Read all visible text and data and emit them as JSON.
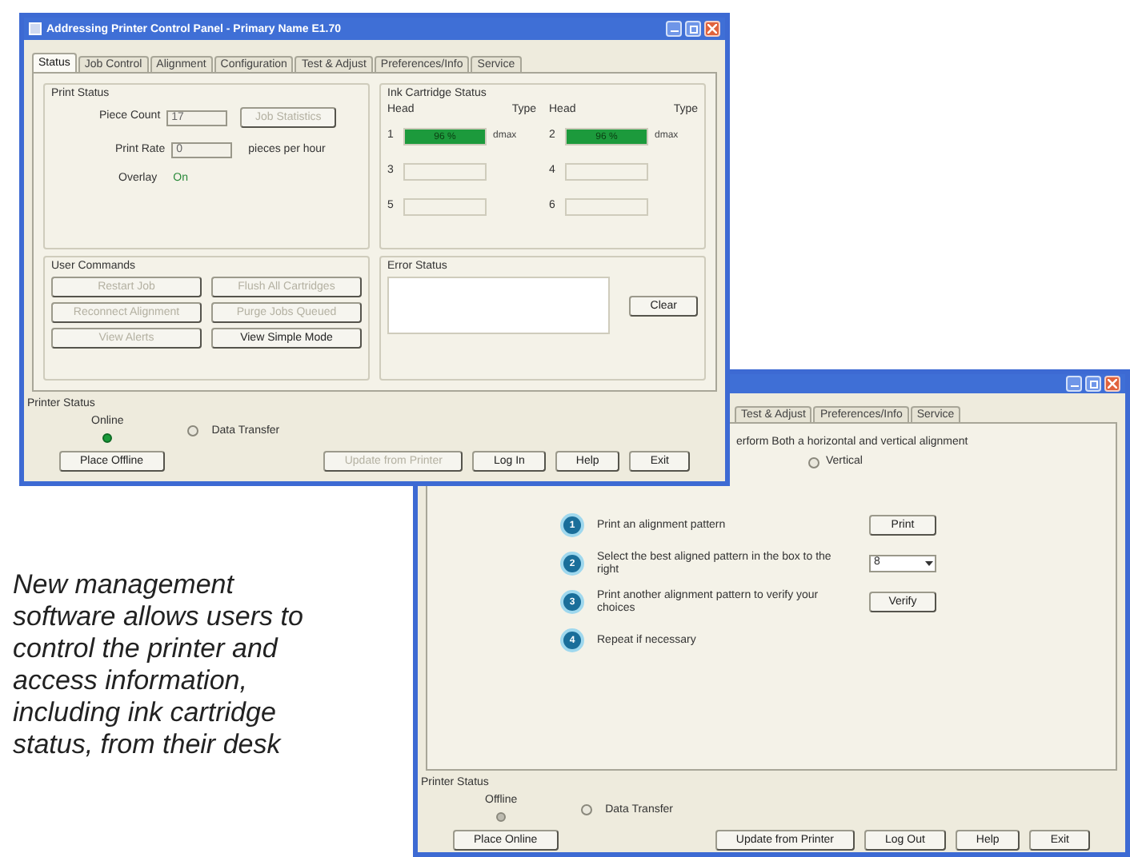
{
  "main_window": {
    "title": "Addressing Printer Control Panel - Primary Name E1.70",
    "tabs": [
      {
        "label": "Status",
        "selected": true
      },
      {
        "label": "Job Control",
        "selected": false
      },
      {
        "label": "Alignment",
        "selected": false
      },
      {
        "label": "Configuration",
        "selected": false
      },
      {
        "label": "Test & Adjust",
        "selected": false
      },
      {
        "label": "Preferences/Info",
        "selected": false
      },
      {
        "label": "Service",
        "selected": false
      }
    ],
    "print_status": {
      "title": "Print Status",
      "piece_count_label": "Piece Count",
      "piece_count_value": "17",
      "statistics_button": "Job Statistics",
      "print_rate_label": "Print Rate",
      "print_rate_value": "0",
      "print_rate_unit": "pieces per hour",
      "overlay_label": "Overlay",
      "overlay_value": "On"
    },
    "ink_cartridge_status": {
      "title": "Ink Cartridge Status",
      "columns": [
        {
          "head": "Head",
          "type": "Type"
        },
        {
          "head": "Head",
          "type": "Type"
        }
      ],
      "cartridges": [
        {
          "number": "1",
          "reading": "96 %",
          "type": "dmax",
          "level": 1
        },
        {
          "number": "2",
          "reading": "96 %",
          "type": "dmax",
          "level": 1
        },
        {
          "number": "3"
        },
        {
          "number": "4"
        },
        {
          "number": "5"
        },
        {
          "number": "6"
        }
      ]
    },
    "user_commands": {
      "title": "User Commands",
      "buttons": [
        {
          "label": "Restart Job",
          "disabled": true
        },
        {
          "label": "Flush All Cartridges",
          "disabled": true
        },
        {
          "label": "Reconnect Alignment",
          "disabled": true
        },
        {
          "label": "Purge Jobs Queued",
          "disabled": true
        },
        {
          "label": "View Alerts",
          "disabled": true
        },
        {
          "label": "View Simple Mode",
          "disabled": false
        }
      ]
    },
    "error_status": {
      "title": "Error Status",
      "clear_button": "Clear"
    },
    "printer_status": {
      "title": "Printer Status",
      "indicator_label": "Online",
      "indicator_on": true,
      "data_transfer_label": "Data Transfer",
      "data_transfer_selected": false
    },
    "buttons": [
      {
        "label": "Place Offline",
        "disabled": false,
        "kind": "left"
      },
      {
        "label": "Update from Printer",
        "disabled": true,
        "kind": "right"
      },
      {
        "label": "Log In",
        "disabled": false,
        "kind": "right"
      },
      {
        "label": "Help",
        "disabled": false,
        "kind": "right"
      },
      {
        "label": "Exit",
        "disabled": false,
        "kind": "right"
      }
    ]
  },
  "alignment_window": {
    "tabs": [
      {
        "label": "Test & Adjust",
        "selected": false
      },
      {
        "label": "Preferences/Info",
        "selected": false
      },
      {
        "label": "Service",
        "selected": false
      }
    ],
    "instruction": "erform Both a horizontal and vertical alignment",
    "orientation_option": {
      "label": "Vertical",
      "selected": false
    },
    "steps": [
      {
        "number": "1",
        "text": "Print an alignment pattern",
        "kind": "button",
        "control": "Print"
      },
      {
        "number": "2",
        "text": "Select the best aligned pattern in the box to the right",
        "kind": "dropdown",
        "control": "8"
      },
      {
        "number": "3",
        "text": "Print another alignment pattern to verify your choices",
        "kind": "button",
        "control": "Verify"
      },
      {
        "number": "4",
        "text": "Repeat if necessary",
        "kind": "none"
      }
    ],
    "printer_status": {
      "title": "Printer Status",
      "indicator_label": "Offline",
      "indicator_on": false,
      "data_transfer_label": "Data Transfer",
      "data_transfer_selected": false
    },
    "buttons": [
      {
        "label": "Place Online",
        "disabled": false,
        "kind": "left"
      },
      {
        "label": "Update from Printer",
        "disabled": false,
        "kind": "right"
      },
      {
        "label": "Log Out",
        "disabled": false,
        "kind": "right"
      },
      {
        "label": "Help",
        "disabled": false,
        "kind": "right"
      },
      {
        "label": "Exit",
        "disabled": false,
        "kind": "right"
      }
    ]
  },
  "caption": "New management software allows users to control the printer and access information, including ink cartridge status, from their desk"
}
